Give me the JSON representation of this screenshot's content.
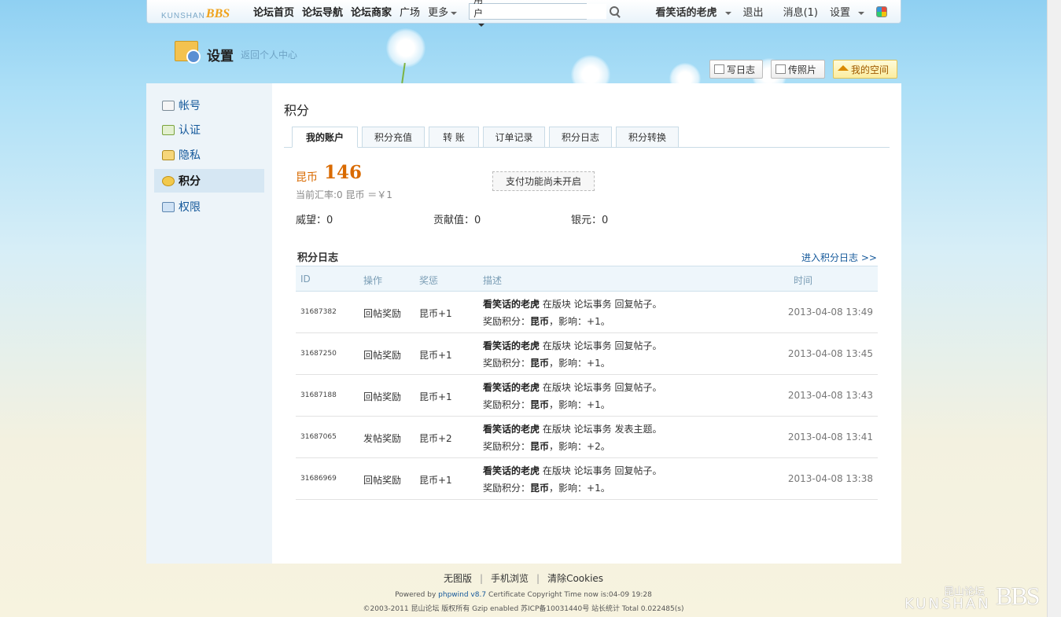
{
  "topbar": {
    "logo_small": "KUNSHAN",
    "logo_big": "BBS",
    "nav": [
      "论坛首页",
      "论坛导航",
      "论坛商家",
      "广场"
    ],
    "more": "更多",
    "search_scope": "用户",
    "search_placeholder": "",
    "username": "看笑话的老虎",
    "logout": "退出",
    "messages": "消息(1)",
    "settings": "设置"
  },
  "banner": {
    "title": "设置",
    "back": "返回个人中心",
    "buttons": {
      "diary": "写日志",
      "photo": "传照片",
      "space": "我的空间"
    }
  },
  "sidebar": {
    "items": [
      {
        "label": "帐号",
        "active": false
      },
      {
        "label": "认证",
        "active": false
      },
      {
        "label": "隐私",
        "active": false
      },
      {
        "label": "积分",
        "active": true
      },
      {
        "label": "权限",
        "active": false
      }
    ]
  },
  "main": {
    "title": "积分",
    "tabs": [
      "我的账户",
      "积分充值",
      "转 账",
      "订单记录",
      "积分日志",
      "积分转换"
    ],
    "active_tab": "我的账户",
    "balance_name": "昆币",
    "balance_value": "146",
    "rate_text": "当前汇率:0 昆币 ＝￥1",
    "pay_note": "支付功能尚未开启",
    "stats": {
      "prestige": "威望：0",
      "contribution": "贡献值：0",
      "silver": "银元：0"
    },
    "log_title": "积分日志",
    "log_link": "进入积分日志 >>",
    "columns": [
      "ID",
      "操作",
      "奖惩",
      "描述",
      "时间"
    ],
    "rows": [
      {
        "id": "31687382",
        "op": "回帖奖励",
        "reward": "昆币+1",
        "who": "看笑话的老虎",
        "desc": " 在版块 论坛事务 回复帖子。",
        "detail_pre": "奖励积分：",
        "detail_cur": "昆币",
        "detail_post": "，影响：+1。",
        "time": "2013-04-08 13:49"
      },
      {
        "id": "31687250",
        "op": "回帖奖励",
        "reward": "昆币+1",
        "who": "看笑话的老虎",
        "desc": " 在版块 论坛事务 回复帖子。",
        "detail_pre": "奖励积分：",
        "detail_cur": "昆币",
        "detail_post": "，影响：+1。",
        "time": "2013-04-08 13:45"
      },
      {
        "id": "31687188",
        "op": "回帖奖励",
        "reward": "昆币+1",
        "who": "看笑话的老虎",
        "desc": " 在版块 论坛事务 回复帖子。",
        "detail_pre": "奖励积分：",
        "detail_cur": "昆币",
        "detail_post": "，影响：+1。",
        "time": "2013-04-08 13:43"
      },
      {
        "id": "31687065",
        "op": "发帖奖励",
        "reward": "昆币+2",
        "who": "看笑话的老虎",
        "desc": " 在版块 论坛事务 发表主题。",
        "detail_pre": "奖励积分：",
        "detail_cur": "昆币",
        "detail_post": "，影响：+2。",
        "time": "2013-04-08 13:41"
      },
      {
        "id": "31686969",
        "op": "回帖奖励",
        "reward": "昆币+1",
        "who": "看笑话的老虎",
        "desc": " 在版块 论坛事务 回复帖子。",
        "detail_pre": "奖励积分：",
        "detail_cur": "昆币",
        "detail_post": "，影响：+1。",
        "time": "2013-04-08 13:38"
      }
    ]
  },
  "footer": {
    "links": [
      "无图版",
      "手机浏览",
      "清除Cookies"
    ],
    "powered_pre": "Powered by ",
    "powered_link": "phpwind v8.7",
    "powered_post": " Certificate Copyright Time now is:04-09 19:28",
    "copyright": "©2003-2011 昆山论坛 版权所有 Gzip enabled 苏ICP备10031440号 站长统计 Total 0.022485(s)",
    "logo_cn": "昆山论坛",
    "logo_en": "KUNSHAN",
    "logo_big": "BBS"
  },
  "colors": {
    "accent": "#d96a00",
    "link": "#14589a",
    "sidebar_bg": "#edf4f9"
  }
}
